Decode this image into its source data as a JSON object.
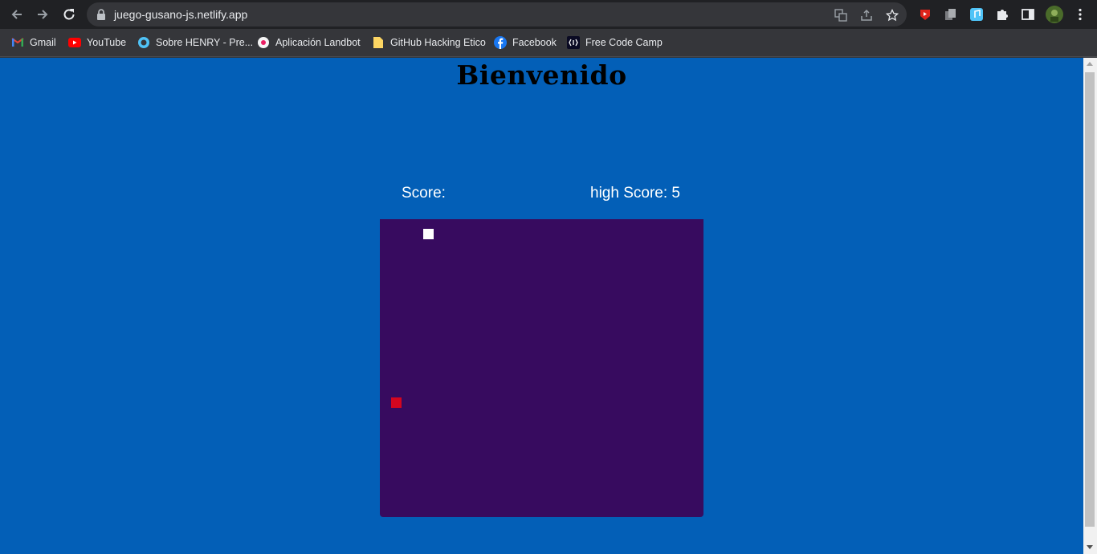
{
  "browser": {
    "url": "juego-gusano-js.netlify.app",
    "bookmarks": [
      {
        "label": "Gmail",
        "icon": "gmail-icon"
      },
      {
        "label": "YouTube",
        "icon": "youtube-icon"
      },
      {
        "label": "Sobre HENRY - Pre...",
        "icon": "henry-icon"
      },
      {
        "label": "Aplicación Landbot",
        "icon": "landbot-icon"
      },
      {
        "label": "GitHub Hacking Etico",
        "icon": "folder-icon"
      },
      {
        "label": "Facebook",
        "icon": "facebook-icon"
      },
      {
        "label": "Free Code Camp",
        "icon": "freecodecamp-icon"
      }
    ]
  },
  "page": {
    "title": "Bienvenido",
    "score_label": "Score:",
    "high_score_label": "high Score: 5"
  },
  "colors": {
    "background": "#035fb7",
    "board": "#370b5f",
    "snake": "#ffffff",
    "food": "#d4061f"
  }
}
